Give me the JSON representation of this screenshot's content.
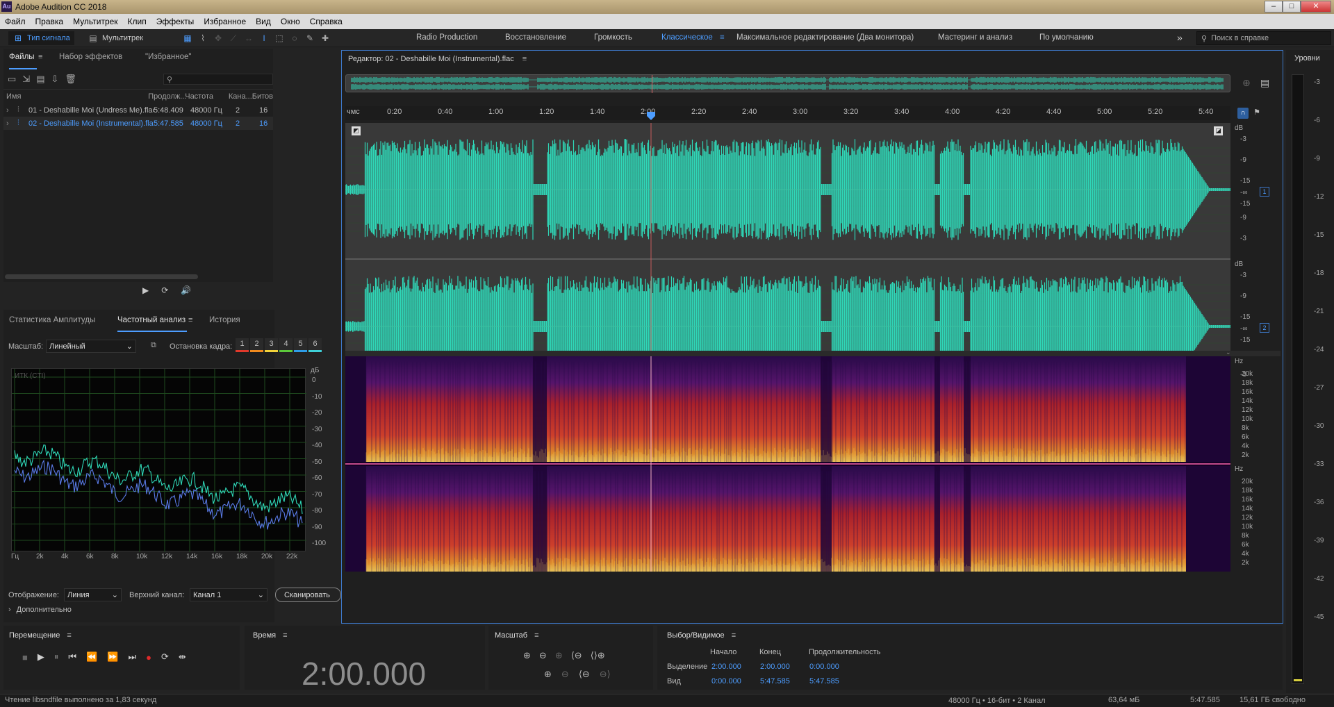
{
  "app": {
    "title": "Adobe Audition CC 2018",
    "logo": "Au"
  },
  "menu": [
    "Файл",
    "Правка",
    "Мультитрек",
    "Клип",
    "Эффекты",
    "Избранное",
    "Вид",
    "Окно",
    "Справка"
  ],
  "toolbar": {
    "waveform_label": "Тип сигнала",
    "multitrack_label": "Мультитрек",
    "workspaces": [
      "Radio Production",
      "Восстановление",
      "Громкость",
      "Классическое",
      "Максимальное редактирование (Два монитора)",
      "Мастеринг и анализ",
      "По умолчанию"
    ],
    "active_workspace": "Классическое",
    "help_search_placeholder": "Поиск в справке"
  },
  "files_panel": {
    "tabs": [
      "Файлы",
      "Набор эффектов",
      "\"Избранное\""
    ],
    "columns": [
      "Имя",
      "Продолж...",
      "Частота",
      "Кана...",
      "Битов"
    ],
    "rows": [
      {
        "name": "01 - Deshabille Moi (Undress Me).flac",
        "duration": "5:48.409",
        "rate": "48000 Гц",
        "channels": "2",
        "bits": "16",
        "selected": false
      },
      {
        "name": "02 - Deshabille Moi (Instrumental).flac",
        "duration": "5:47.585",
        "rate": "48000 Гц",
        "channels": "2",
        "bits": "16",
        "selected": true
      }
    ]
  },
  "analysis_panel": {
    "tabs": [
      "Статистика Амплитуды",
      "Частотный анализ",
      "История"
    ],
    "scale_label": "Масштаб:",
    "scale_value": "Линейный",
    "freeze_label": "Остановка кадра:",
    "freeze_slots": [
      "1",
      "2",
      "3",
      "4",
      "5",
      "6"
    ],
    "freeze_colors": [
      "#e0392b",
      "#f08a1e",
      "#f2d23a",
      "#5cc93b",
      "#2e9de8",
      "#3fd0d8"
    ],
    "cti_label": "ИТК (CTI)",
    "db_unit": "дБ",
    "db_ticks": [
      "0",
      "-10",
      "-20",
      "-30",
      "-40",
      "-50",
      "-60",
      "-70",
      "-80",
      "-90",
      "-100"
    ],
    "hz_ticks": [
      "Гц",
      "2k",
      "4k",
      "6k",
      "8k",
      "10k",
      "12k",
      "14k",
      "16k",
      "18k",
      "20k",
      "22k"
    ],
    "display_label": "Отображение:",
    "display_value": "Линия",
    "top_channel_label": "Верхний канал:",
    "top_channel_value": "Канал 1",
    "scan_button": "Сканировать",
    "more_label": "Дополнительно"
  },
  "editor": {
    "title": "Редактор: 02 - Deshabille Moi (Instrumental).flac",
    "timeline_unit": "чмс",
    "timeline_ticks": [
      "0:20",
      "0:40",
      "1:00",
      "1:20",
      "1:40",
      "2:00",
      "2:20",
      "2:40",
      "3:00",
      "3:20",
      "3:40",
      "4:00",
      "4:20",
      "4:40",
      "5:00",
      "5:20",
      "5:40"
    ],
    "playhead_fraction": 0.345,
    "db_unit": "dB",
    "db_ticks": [
      "-3",
      "-9",
      "-15",
      "-∞",
      "-15",
      "-9",
      "-3"
    ],
    "hz_unit": "Hz",
    "hz_ticks": [
      "20k",
      "18k",
      "16k",
      "14k",
      "12k",
      "10k",
      "8k",
      "6k",
      "4k",
      "2k"
    ],
    "channel_1": "1",
    "channel_2": "2",
    "wave_color": "#2fd8b8"
  },
  "levels": {
    "title": "Уровни",
    "ticks": [
      "-3",
      "-6",
      "-9",
      "-12",
      "-15",
      "-18",
      "-21",
      "-24",
      "-27",
      "-30",
      "-33",
      "-36",
      "-39",
      "-42",
      "-45"
    ]
  },
  "transport": {
    "title": "Перемещение"
  },
  "time_panel": {
    "title": "Время",
    "value": "2:00.000"
  },
  "zoom_panel": {
    "title": "Масштаб"
  },
  "selection_panel": {
    "title": "Выбор/Видимое",
    "headers": [
      "Начало",
      "Конец",
      "Продолжительность"
    ],
    "rows": [
      {
        "label": "Выделение",
        "start": "2:00.000",
        "end": "2:00.000",
        "duration": "0:00.000"
      },
      {
        "label": "Вид",
        "start": "0:00.000",
        "end": "5:47.585",
        "duration": "5:47.585"
      }
    ]
  },
  "status": {
    "message": "Чтение libsndfile выполнено за 1,83 секунд",
    "format": "48000 Гц • 16-бит • 2 Канал",
    "size": "63,64 мБ",
    "duration": "5:47.585",
    "free": "15,61 ГБ свободно"
  }
}
